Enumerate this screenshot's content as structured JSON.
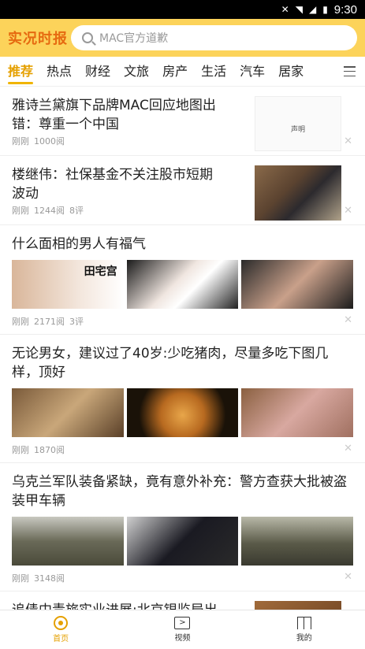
{
  "status_bar": {
    "time": "9:30"
  },
  "header": {
    "logo": "实况时报",
    "search_placeholder": "MAC官方道歉"
  },
  "tabs": [
    {
      "label": "推荐",
      "active": true
    },
    {
      "label": "热点"
    },
    {
      "label": "财经"
    },
    {
      "label": "文旅"
    },
    {
      "label": "房产"
    },
    {
      "label": "生活"
    },
    {
      "label": "汽车"
    },
    {
      "label": "居家"
    }
  ],
  "feed": [
    {
      "title": "雅诗兰黛旗下品牌MAC回应地图出错：尊重一个中国",
      "time": "刚刚",
      "views": "1000阅",
      "comments": "",
      "thumb_texts": [
        "声明"
      ]
    },
    {
      "title": "楼继伟：社保基金不关注股市短期波动",
      "time": "刚刚",
      "views": "1244阅",
      "comments": "8评"
    },
    {
      "title": "什么面相的男人有福气",
      "time": "刚刚",
      "views": "2171阅",
      "comments": "3评",
      "image_caption": "田宅宫"
    },
    {
      "title": "无论男女，建议过了40岁:少吃猪肉，尽量多吃下图几样，顶好",
      "time": "刚刚",
      "views": "1870阅",
      "comments": ""
    },
    {
      "title": "乌克兰军队装备紧缺，竟有意外补充：警方查获大批被盗装甲车辆",
      "time": "刚刚",
      "views": "3148阅",
      "comments": ""
    },
    {
      "title": "追债中青旅实业进展:北京银监局出面",
      "time": "",
      "views": "",
      "comments": ""
    }
  ],
  "bottom_nav": [
    {
      "label": "首页",
      "active": true
    },
    {
      "label": "视频"
    },
    {
      "label": "我的"
    }
  ],
  "colors": {
    "accent": "#f0b400",
    "header_bg": "#fcd35a",
    "logo": "#e66a10"
  }
}
